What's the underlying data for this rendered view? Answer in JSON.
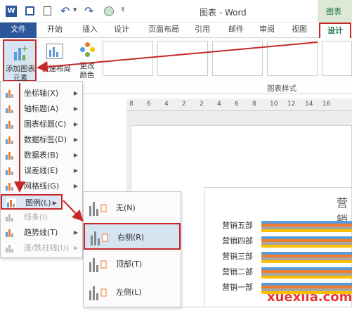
{
  "window": {
    "title": "图表 - Word",
    "chart_tools_label": "图表",
    "active_tab": "设计"
  },
  "tabs": [
    "文件",
    "开始",
    "插入",
    "设计",
    "页面布局",
    "引用",
    "邮件",
    "审阅",
    "视图",
    "设计"
  ],
  "ribbon": {
    "add_element": "添加图表\n元素",
    "add_element_line1": "添加图表",
    "add_element_line2": "元素",
    "quick_layout": "快速布局",
    "change_colors_line1": "更改",
    "change_colors_line2": "颜色",
    "chart_styles_label": "图表样式"
  },
  "ruler_ticks": [
    "8",
    "6",
    "4",
    "2",
    "2",
    "4",
    "6",
    "8",
    "10",
    "12",
    "14",
    "16"
  ],
  "element_menu": [
    {
      "label": "坐标轴(X)",
      "disabled": false
    },
    {
      "label": "轴标题(A)",
      "disabled": false
    },
    {
      "label": "图表标题(C)",
      "disabled": false
    },
    {
      "label": "数据标签(D)",
      "disabled": false
    },
    {
      "label": "数据表(B)",
      "disabled": false
    },
    {
      "label": "误差线(E)",
      "disabled": false
    },
    {
      "label": "网格线(G)",
      "disabled": false
    },
    {
      "label": "图例(L)",
      "disabled": false
    },
    {
      "label": "线条(I)",
      "disabled": true
    },
    {
      "label": "趋势线(T)",
      "disabled": false
    },
    {
      "label": "涨/跌柱线(U)",
      "disabled": true
    }
  ],
  "legend_menu": [
    {
      "label": "无(N)"
    },
    {
      "label": "右侧(R)"
    },
    {
      "label": "顶部(T)"
    },
    {
      "label": "左侧(L)"
    }
  ],
  "chart": {
    "title_partial": "营销",
    "categories": [
      "营销五部",
      "营销四部",
      "营销三部",
      "营销二部",
      "营销一部"
    ]
  },
  "watermark": "xuexila.com"
}
